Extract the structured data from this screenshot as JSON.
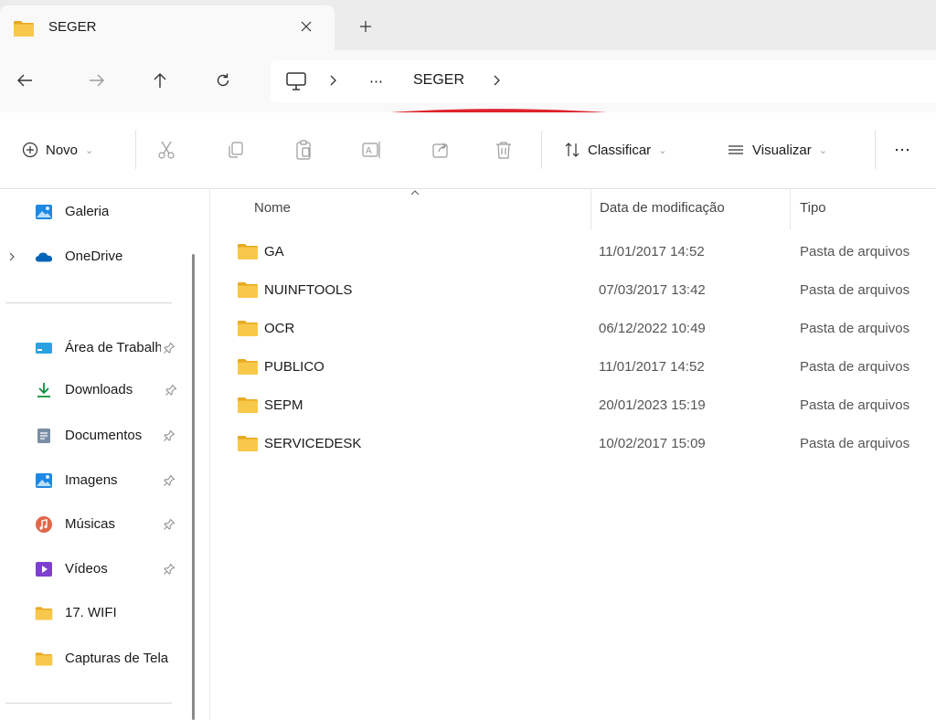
{
  "tab": {
    "title": "SEGER"
  },
  "address": {
    "overflow": "⋯",
    "crumb": "SEGER"
  },
  "toolbar": {
    "new_label": "Novo",
    "sort_label": "Classificar",
    "view_label": "Visualizar",
    "more_label": "⋯"
  },
  "sidebar": {
    "top_items": [
      {
        "label": "Galeria",
        "icon": "gallery-icon"
      },
      {
        "label": "OneDrive",
        "icon": "onedrive-icon"
      }
    ],
    "pinned_items": [
      {
        "label": "Área de Trabalho",
        "icon": "desktop-icon"
      },
      {
        "label": "Downloads",
        "icon": "download-icon"
      },
      {
        "label": "Documentos",
        "icon": "documents-icon"
      },
      {
        "label": "Imagens",
        "icon": "pictures-icon"
      },
      {
        "label": "Músicas",
        "icon": "music-icon"
      },
      {
        "label": "Vídeos",
        "icon": "videos-icon"
      },
      {
        "label": "17. WIFI",
        "icon": "folder-icon"
      },
      {
        "label": "Capturas de Tela",
        "icon": "folder-icon"
      }
    ]
  },
  "columns": {
    "name": "Nome",
    "date": "Data de modificação",
    "type": "Tipo"
  },
  "files": [
    {
      "name": "GA",
      "date": "11/01/2017 14:52",
      "type": "Pasta de arquivos"
    },
    {
      "name": "NUINFTOOLS",
      "date": "07/03/2017 13:42",
      "type": "Pasta de arquivos"
    },
    {
      "name": "OCR",
      "date": "06/12/2022 10:49",
      "type": "Pasta de arquivos"
    },
    {
      "name": "PUBLICO",
      "date": "11/01/2017 14:52",
      "type": "Pasta de arquivos"
    },
    {
      "name": "SEPM",
      "date": "20/01/2023 15:19",
      "type": "Pasta de arquivos"
    },
    {
      "name": "SERVICEDESK",
      "date": "10/02/2017 15:09",
      "type": "Pasta de arquivos"
    }
  ],
  "colors": {
    "folder": "#F8C84A",
    "folder_dark": "#E8A920",
    "accent": "#0067C0",
    "annotation": "#E0232B"
  }
}
